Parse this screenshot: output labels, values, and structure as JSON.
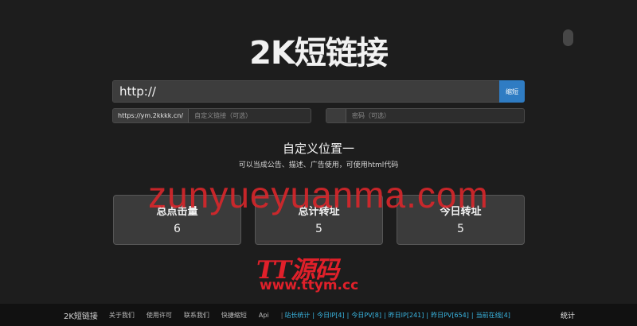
{
  "header": {
    "title": "2K短链接"
  },
  "form": {
    "url_value": "http://",
    "shorten_label": "缩短",
    "domain_prefix": "https://ym.2kkkk.cn/",
    "custom_placeholder": "自定义链接（可选）",
    "password_placeholder": "密码（可选）"
  },
  "custom_block": {
    "title": "自定义位置一",
    "subtitle": "可以当成公告、描述、广告使用，可使用html代码"
  },
  "watermark": {
    "text": "zunyueyuanma.com",
    "logo_text": "TT源码",
    "logo_url": "www.ttym.cc"
  },
  "stats": [
    {
      "label": "总点击量",
      "value": "6"
    },
    {
      "label": "总计转址",
      "value": "5"
    },
    {
      "label": "今日转址",
      "value": "5"
    }
  ],
  "footer": {
    "brand": "2K短链接",
    "links": [
      "关于我们",
      "使用许可",
      "联系我们",
      "快捷缩短",
      "Api"
    ],
    "site_stats": [
      "站长统计",
      "今日IP[4]",
      "今日PV[8]",
      "昨日IP[241]",
      "昨日PV[654]",
      "当前在线[4]"
    ],
    "right_link": "统计"
  },
  "colors": {
    "background": "#1d1d1d",
    "accent_button": "#2f7cc3",
    "watermark": "#d9262b",
    "footer_stats": "#3ab7e3"
  }
}
